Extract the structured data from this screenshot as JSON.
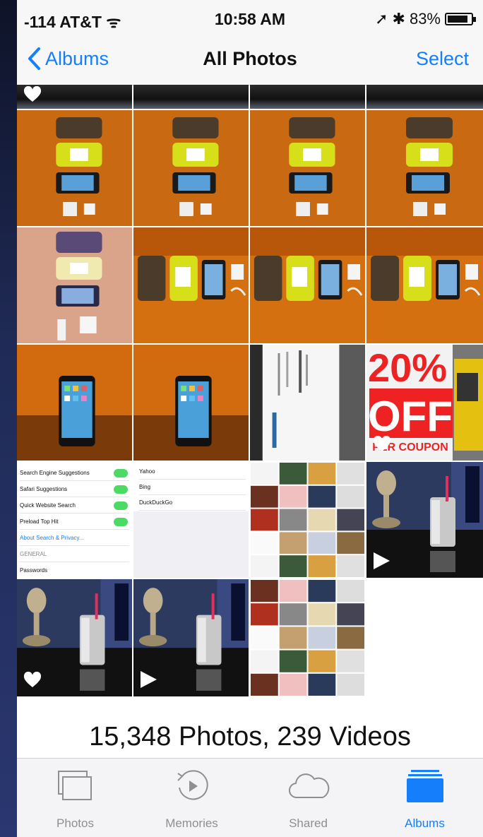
{
  "status_bar": {
    "carrier": "-114 AT&T",
    "time": "10:58 AM",
    "battery": "83%"
  },
  "nav": {
    "back_label": "Albums",
    "title": "All Photos",
    "select_label": "Select"
  },
  "library": {
    "summary": "15,348 Photos, 239 Videos"
  },
  "tabs": [
    {
      "label": "Photos",
      "icon": "photos-stack-icon",
      "active": false
    },
    {
      "label": "Memories",
      "icon": "memories-icon",
      "active": false
    },
    {
      "label": "Shared",
      "icon": "cloud-icon",
      "active": false
    },
    {
      "label": "Albums",
      "icon": "albums-icon",
      "active": true
    }
  ],
  "thumbnails": [
    {
      "name": "photo-tile-row0-1",
      "kind": "dark-strip",
      "favorite": true
    },
    {
      "name": "photo-tile-row0-2",
      "kind": "dark-strip"
    },
    {
      "name": "photo-tile-row0-3",
      "kind": "dark-strip"
    },
    {
      "name": "photo-tile-row0-4",
      "kind": "dark-strip"
    },
    {
      "name": "photo-tile-r1c1",
      "kind": "phones-vertical"
    },
    {
      "name": "photo-tile-r1c2",
      "kind": "phones-vertical"
    },
    {
      "name": "photo-tile-r1c3",
      "kind": "phones-vertical"
    },
    {
      "name": "photo-tile-r1c4",
      "kind": "phones-vertical"
    },
    {
      "name": "photo-tile-r2c1",
      "kind": "phones-vertical-pale"
    },
    {
      "name": "photo-tile-r2c2",
      "kind": "phones-horizontal"
    },
    {
      "name": "photo-tile-r2c3",
      "kind": "phones-horizontal"
    },
    {
      "name": "photo-tile-r2c4",
      "kind": "phones-horizontal"
    },
    {
      "name": "photo-tile-r3c1",
      "kind": "phone-stand"
    },
    {
      "name": "photo-tile-r3c2",
      "kind": "phone-stand"
    },
    {
      "name": "photo-tile-r3c3",
      "kind": "business-card"
    },
    {
      "name": "photo-tile-r3c4",
      "kind": "coupon",
      "favorite": true,
      "coupon_top": "20%",
      "coupon_mid": "OFF",
      "coupon_bottom": "PER COUPON"
    },
    {
      "name": "photo-tile-r4c1",
      "kind": "settings-screenshot",
      "lines": [
        "Search Engine Suggestions",
        "Safari Suggestions",
        "Quick Website Search",
        "Preload Top Hit",
        "About Search & Privacy...",
        "GENERAL",
        "Passwords"
      ]
    },
    {
      "name": "photo-tile-r4c2",
      "kind": "settings-list",
      "lines": [
        "Yahoo",
        "Bing",
        "DuckDuckGo"
      ]
    },
    {
      "name": "photo-tile-r4c3",
      "kind": "collage"
    },
    {
      "name": "photo-tile-r4c4",
      "kind": "cup",
      "video": true
    },
    {
      "name": "photo-tile-r5c1",
      "kind": "cup",
      "favorite": true
    },
    {
      "name": "photo-tile-r5c2",
      "kind": "cup",
      "video": true
    },
    {
      "name": "photo-tile-r5c3",
      "kind": "collage"
    }
  ],
  "colors": {
    "accent": "#147efb",
    "inactive": "#8e8e93"
  }
}
